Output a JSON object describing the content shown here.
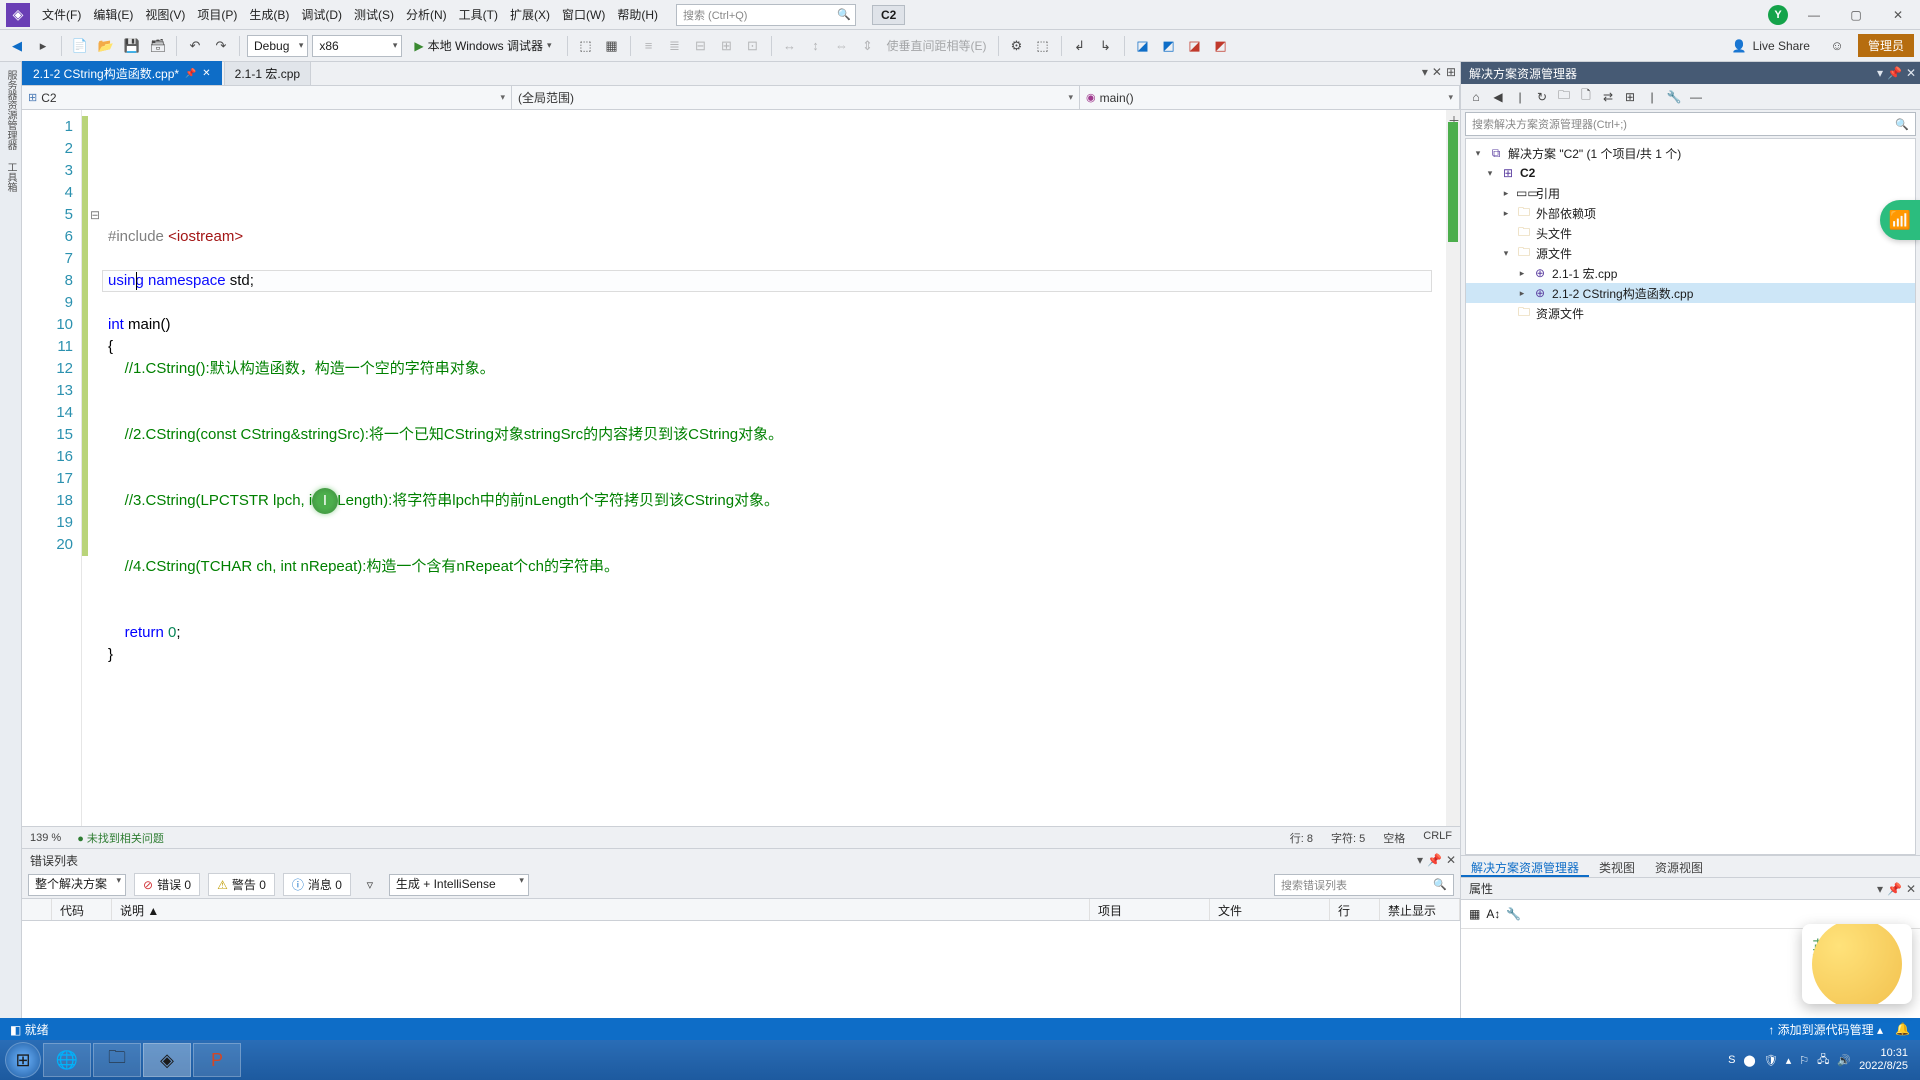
{
  "menubar": {
    "items": [
      "文件(F)",
      "编辑(E)",
      "视图(V)",
      "项目(P)",
      "生成(B)",
      "调试(D)",
      "测试(S)",
      "分析(N)",
      "工具(T)",
      "扩展(X)",
      "窗口(W)",
      "帮助(H)"
    ],
    "search_placeholder": "搜索 (Ctrl+Q)",
    "project_badge": "C2"
  },
  "titlebar_avatar": "Y",
  "toolbar": {
    "config": "Debug",
    "platform": "x86",
    "run_label": "本地 Windows 调试器",
    "disabled_label": "使垂直间距相等(E)",
    "liveshare": "Live Share",
    "admin": "管理员"
  },
  "tabs": {
    "active": "2.1-2 CString构造函数.cpp*",
    "other": "2.1-1 宏.cpp"
  },
  "nav": {
    "scope1": "C2",
    "scope2": "(全局范围)",
    "scope3": "main()"
  },
  "code": {
    "lines": [
      {
        "n": 1,
        "html": "<span class='inc'>#include</span> <span class='str'>&lt;iostream&gt;</span>"
      },
      {
        "n": 2,
        "html": ""
      },
      {
        "n": 3,
        "html": "<span class='kw'>using</span> <span class='kw'>namespace</span> std;"
      },
      {
        "n": 4,
        "html": ""
      },
      {
        "n": 5,
        "html": "<span class='kw'>int</span> main()",
        "fold": "⊟"
      },
      {
        "n": 6,
        "html": "{"
      },
      {
        "n": 7,
        "html": "    <span class='cmt'>//1.CString():默认构造函数，构造一个空的字符串对象。</span>"
      },
      {
        "n": 8,
        "html": "    "
      },
      {
        "n": 9,
        "html": ""
      },
      {
        "n": 10,
        "html": "    <span class='cmt'>//2.CString(const CString&amp;stringSrc):将一个已知CString对象stringSrc的内容拷贝到该CString对象。</span>"
      },
      {
        "n": 11,
        "html": ""
      },
      {
        "n": 12,
        "html": ""
      },
      {
        "n": 13,
        "html": "    <span class='cmt'>//3.CString(LPCTSTR lpch, int nLength):将字符串lpch中的前nLength个字符拷贝到该CString对象。</span>"
      },
      {
        "n": 14,
        "html": ""
      },
      {
        "n": 15,
        "html": ""
      },
      {
        "n": 16,
        "html": "    <span class='cmt'>//4.CString(TCHAR ch, int nRepeat):构造一个含有nRepeat个ch的字符串。</span>"
      },
      {
        "n": 17,
        "html": ""
      },
      {
        "n": 18,
        "html": ""
      },
      {
        "n": 19,
        "html": "    <span class='kw'>return</span> <span class='num'>0</span>;"
      },
      {
        "n": 20,
        "html": "}"
      }
    ]
  },
  "editor_status": {
    "zoom": "139 %",
    "issues": "● 未找到相关问题",
    "line": "行: 8",
    "col": "字符: 5",
    "tab": "空格",
    "eol": "CRLF"
  },
  "solution": {
    "title": "解决方案资源管理器",
    "search_placeholder": "搜索解决方案资源管理器(Ctrl+;)",
    "root": "解决方案 \"C2\" (1 个项目/共 1 个)",
    "project": "C2",
    "refs": "引用",
    "external": "外部依赖项",
    "headers": "头文件",
    "sources": "源文件",
    "src1": "2.1-1 宏.cpp",
    "src2": "2.1-2 CString构造函数.cpp",
    "resources": "资源文件",
    "bottom_tabs": [
      "解决方案资源管理器",
      "类视图",
      "资源视图"
    ]
  },
  "properties": {
    "title": "属性"
  },
  "errorlist": {
    "title": "错误列表",
    "scope": "整个解决方案",
    "errors": "错误 0",
    "warnings": "警告 0",
    "messages": "消息 0",
    "filter": "生成 + IntelliSense",
    "search_placeholder": "搜索错误列表",
    "cols": [
      "",
      "代码",
      "说明 ▲",
      "项目",
      "文件",
      "行",
      "禁止显示"
    ]
  },
  "statusbar": {
    "ready": "就绪",
    "source_control": "↑ 添加到源代码管理 ▴"
  },
  "clock": {
    "time": "10:31",
    "date": "2022/8/25"
  }
}
